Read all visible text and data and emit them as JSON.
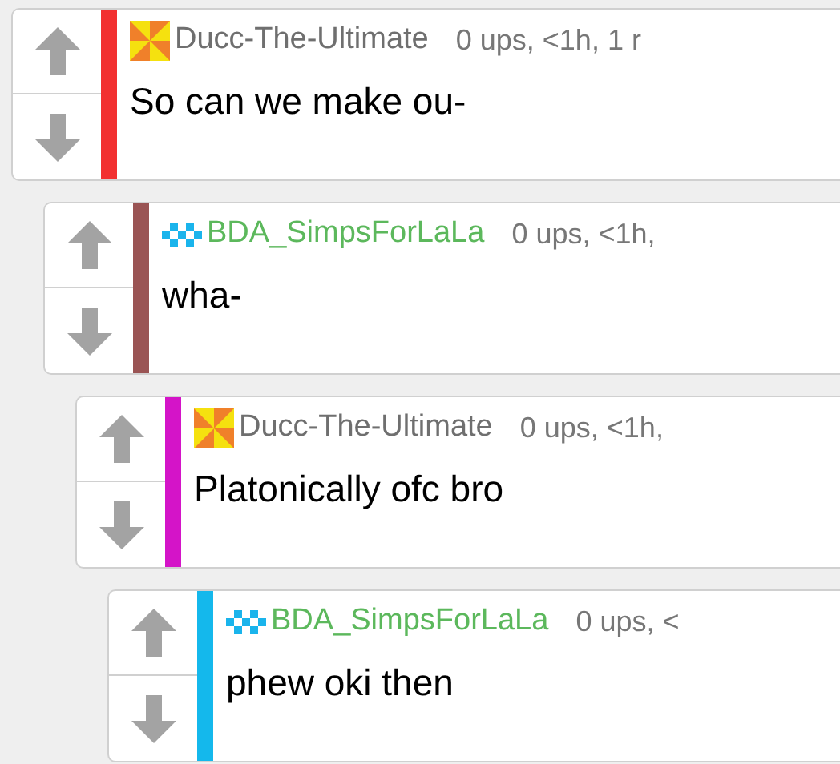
{
  "comments": [
    {
      "kind": "pinwheel",
      "author": "Ducc-The-Ultimate",
      "meta": "0 ups, <1h, 1 r",
      "body": "So can we make ou-",
      "color": "#f23030",
      "children": [
        {
          "kind": "pixel",
          "author": "BDA_SimpsForLaLa",
          "meta": "0 ups, <1h,",
          "body": "wha-",
          "color": "#9a5454",
          "children": [
            {
              "kind": "pinwheel",
              "author": "Ducc-The-Ultimate",
              "meta": "0 ups, <1h,",
              "body": "Platonically ofc bro",
              "color": "#d414c8",
              "children": [
                {
                  "kind": "pixel",
                  "author": "BDA_SimpsForLaLa",
                  "meta": "0 ups, <",
                  "body": "phew oki then",
                  "color": "#14b8ec"
                }
              ]
            }
          ]
        }
      ]
    }
  ]
}
